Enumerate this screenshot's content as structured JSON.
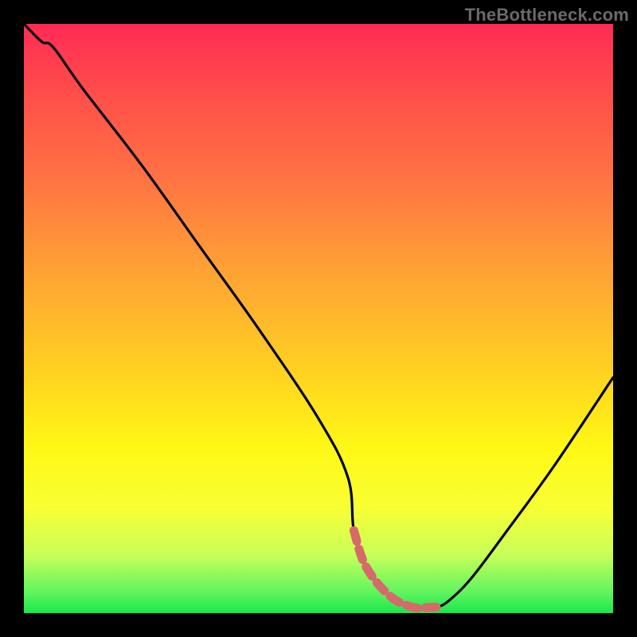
{
  "watermark": "TheBottleneck.com",
  "chart_data": {
    "type": "line",
    "title": "",
    "xlabel": "",
    "ylabel": "",
    "xlim": [
      0,
      100
    ],
    "ylim": [
      0,
      100
    ],
    "x": [
      0,
      3,
      5,
      10,
      20,
      30,
      40,
      50,
      55,
      56,
      58,
      62,
      66,
      69,
      70,
      72,
      76,
      82,
      90,
      100
    ],
    "values": [
      100,
      97,
      96,
      89,
      76,
      62,
      48,
      33,
      23,
      14,
      8,
      3,
      1,
      1,
      1,
      2,
      6,
      14,
      25,
      40
    ],
    "highlight": {
      "x": [
        56,
        58,
        62,
        66,
        69,
        70
      ],
      "values": [
        14,
        8,
        3,
        1,
        1,
        1
      ]
    },
    "gradient_stops": [
      {
        "pos": 0.0,
        "color": "#ff2b55"
      },
      {
        "pos": 0.12,
        "color": "#ff4e4a"
      },
      {
        "pos": 0.26,
        "color": "#ff7243"
      },
      {
        "pos": 0.42,
        "color": "#ffa234"
      },
      {
        "pos": 0.58,
        "color": "#ffce22"
      },
      {
        "pos": 0.72,
        "color": "#fff815"
      },
      {
        "pos": 0.82,
        "color": "#f8ff33"
      },
      {
        "pos": 0.9,
        "color": "#c9ff5a"
      },
      {
        "pos": 0.965,
        "color": "#60f45f"
      },
      {
        "pos": 1.0,
        "color": "#18e84a"
      }
    ],
    "colors": {
      "curve": "#000000",
      "highlight": "#d66a6a",
      "background_frame": "#000000"
    }
  }
}
